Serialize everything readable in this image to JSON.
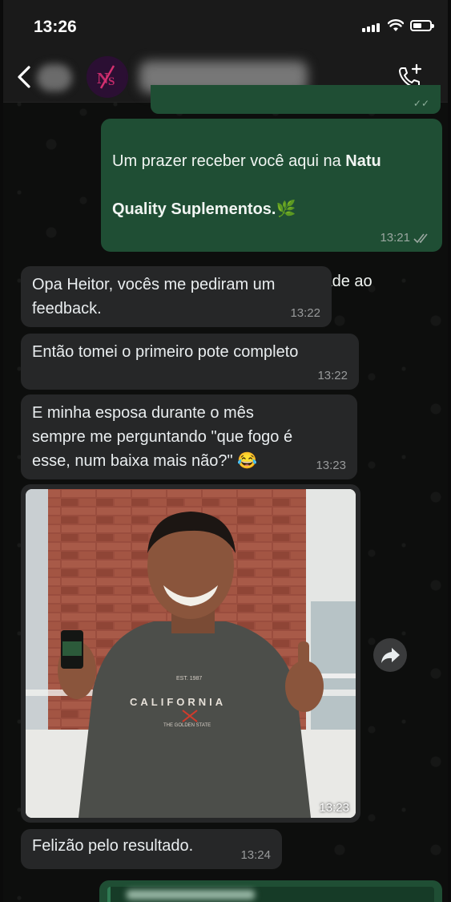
{
  "status_bar": {
    "time": "13:26"
  },
  "header": {
    "back_icon": "chevron-left-icon",
    "call_icon": "phone-plus-icon"
  },
  "messages": [
    {
      "direction": "outgoing",
      "line1_a": "Um prazer receber você aqui na ",
      "line1_b": "Natu",
      "line2_b": "Quality Suplementos.",
      "emoji": "🌿",
      "paragraph2": "Sou o Heitor e darei continuidade ao\nseu atendimento.",
      "time": "13:21",
      "status_icon": "double-check-icon"
    },
    {
      "direction": "incoming",
      "text": "Opa Heitor, vocês me pediram um\nfeedback.",
      "time": "13:22"
    },
    {
      "direction": "incoming",
      "text": "Então tomei o primeiro pote completo",
      "time": "13:22"
    },
    {
      "direction": "incoming",
      "text": "E minha esposa durante o mês\nsempre me perguntando \"que fogo é\nesse, num baixa mais não?\" 😂",
      "time": "13:23"
    },
    {
      "direction": "incoming",
      "type": "image",
      "shirt_text": "CALIFORNIA",
      "shirt_est": "EST. 1987",
      "shirt_sub": "THE GOLDEN STATE",
      "time": "13:23"
    },
    {
      "direction": "incoming",
      "text": "Felizão pelo resultado.",
      "time": "13:24"
    }
  ],
  "share_icon": "forward-arrow-icon",
  "colors": {
    "outgoing": "#1f4e34",
    "incoming": "#262728",
    "background": "#0c0d0c"
  }
}
